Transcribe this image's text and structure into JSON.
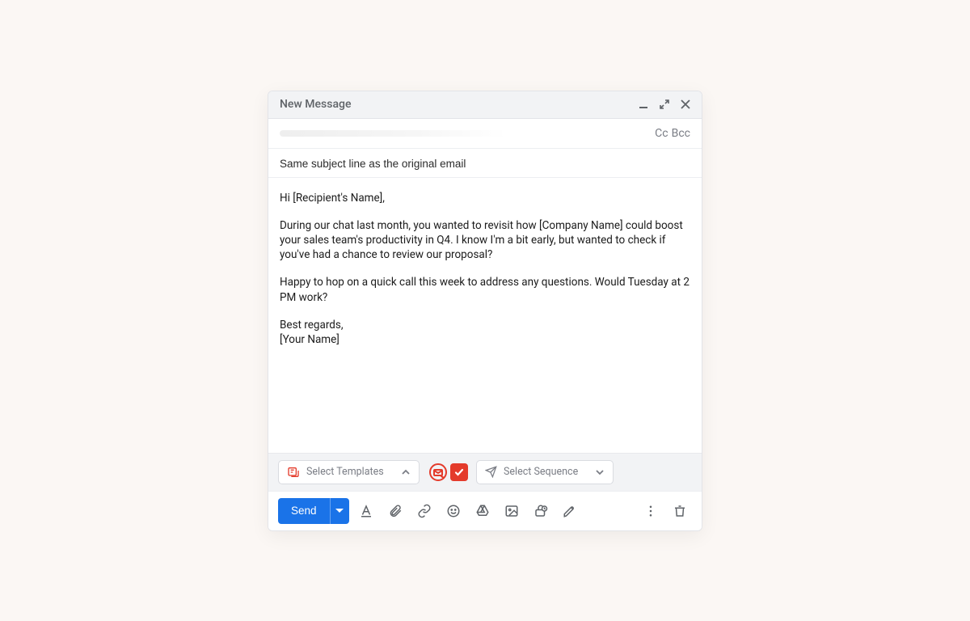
{
  "window": {
    "title": "New Message"
  },
  "recipients": {
    "cc": "Cc",
    "bcc": "Bcc"
  },
  "subject": {
    "value": "Same subject line as the original email"
  },
  "body": {
    "greeting": "Hi [Recipient's Name],",
    "p1": "During our chat last month, you wanted to revisit how [Company Name] could boost your sales team's productivity in Q4. I know I'm a bit early, but wanted to check if you've had a chance to review our proposal?",
    "p2": "Happy to hop on a quick call this week to address any questions. Would Tuesday at 2 PM work?",
    "signoff": "Best regards,",
    "signature": "[Your Name]"
  },
  "toolbar": {
    "templates_label": "Select Templates",
    "sequence_label": "Select Sequence"
  },
  "actions": {
    "send": "Send"
  },
  "colors": {
    "accent": "#1a73e8",
    "brand_red": "#e43b2b"
  }
}
